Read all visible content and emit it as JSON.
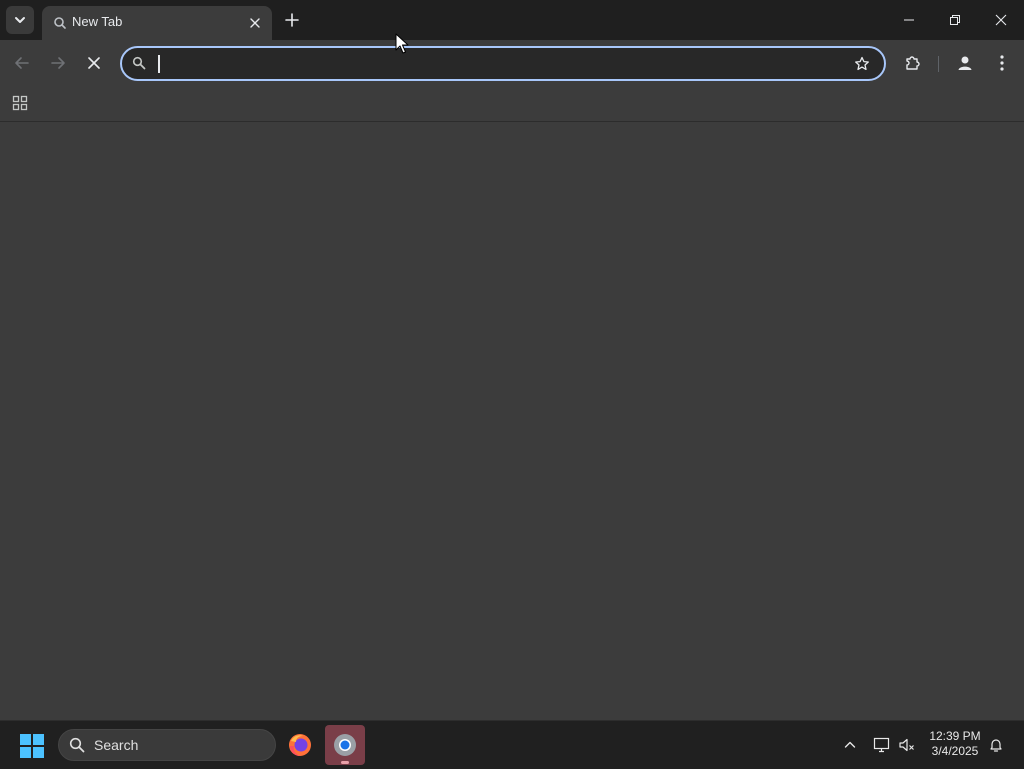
{
  "browser": {
    "tab": {
      "title": "New Tab",
      "favicon": "newtab-icon"
    },
    "omnibox": {
      "value": "",
      "placeholder": ""
    },
    "colors": {
      "frame": "#1f1f1f",
      "toolbar": "#3c3c3c",
      "omnibox_focus": "#a8c7fa"
    }
  },
  "taskbar": {
    "search_label": "Search",
    "apps": [
      "firefox",
      "chrome"
    ],
    "clock": {
      "time": "12:39 PM",
      "date": "3/4/2025"
    }
  }
}
